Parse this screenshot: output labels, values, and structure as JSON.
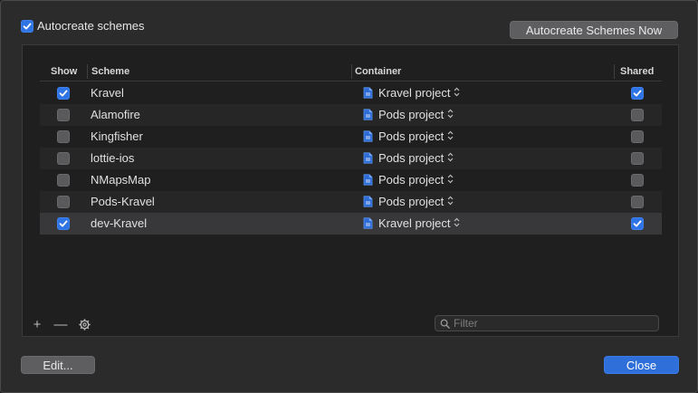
{
  "autocreate": {
    "label": "Autocreate schemes",
    "checked": true,
    "button_label": "Autocreate Schemes Now"
  },
  "table": {
    "columns": {
      "show": "Show",
      "scheme": "Scheme",
      "container": "Container",
      "shared": "Shared"
    },
    "rows": [
      {
        "show": true,
        "scheme": "Kravel",
        "container": "Kravel project",
        "shared": true
      },
      {
        "show": false,
        "scheme": "Alamofire",
        "container": "Pods project",
        "shared": false
      },
      {
        "show": false,
        "scheme": "Kingfisher",
        "container": "Pods project",
        "shared": false
      },
      {
        "show": false,
        "scheme": "lottie-ios",
        "container": "Pods project",
        "shared": false
      },
      {
        "show": false,
        "scheme": "NMapsMap",
        "container": "Pods project",
        "shared": false
      },
      {
        "show": false,
        "scheme": "Pods-Kravel",
        "container": "Pods project",
        "shared": false
      },
      {
        "show": true,
        "scheme": "dev-Kravel",
        "container": "Kravel project",
        "shared": true
      }
    ]
  },
  "tools": {
    "add": "+",
    "remove": "—"
  },
  "filter": {
    "placeholder": "Filter"
  },
  "buttons": {
    "edit": "Edit...",
    "close": "Close"
  },
  "icons": {
    "checkmark": "checkmark-icon",
    "document": "document-icon",
    "stepper": "up-down-chevron-icon",
    "gear": "gear-icon",
    "search": "magnifier-icon"
  },
  "colors": {
    "accent": "#2f74e5",
    "close_button": "#2f6fd9"
  }
}
